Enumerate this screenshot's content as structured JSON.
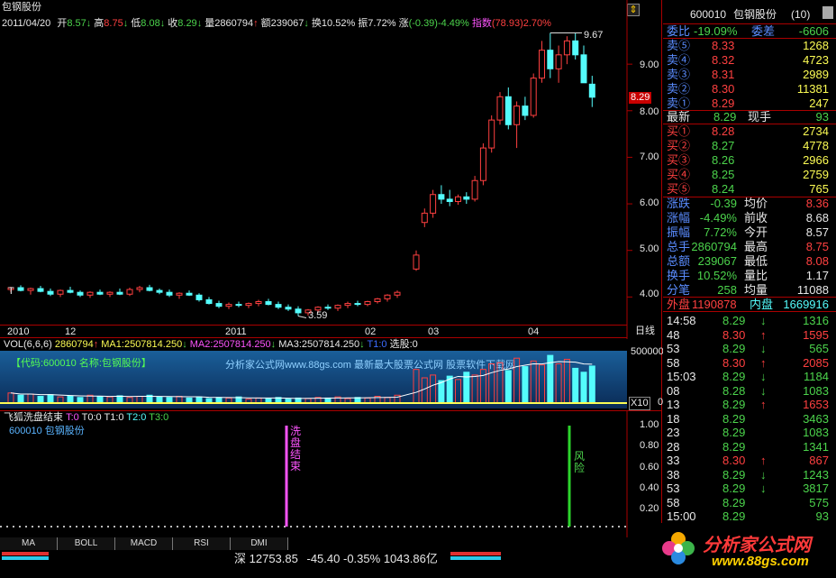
{
  "header": {
    "stock_name": "包钢股份",
    "date": "2011/04/20",
    "open_label": "开",
    "open": "8.57",
    "high_label": "高",
    "high": "8.75",
    "low_label": "低",
    "low": "8.08",
    "close_label": "收",
    "close": "8.29",
    "volume_label": "量",
    "volume": "2860794",
    "amount_label": "额",
    "amount": "239067",
    "turnover_label": "换",
    "turnover": "10.52%",
    "amplitude_label": "振",
    "amplitude": "7.72%",
    "change_label": "涨",
    "change": "(-0.39)-4.49%",
    "index_label": "指数",
    "index": "(78.93)2.70%"
  },
  "chart_data": {
    "type": "candlestick",
    "dates_labels": [
      "2010",
      "12",
      "2011",
      "02",
      "03",
      "04",
      "日线"
    ],
    "price_ticks": [
      "9.00",
      "8.00",
      "7.00",
      "6.00",
      "5.00",
      "4.00"
    ],
    "current_price": "8.29",
    "high_marker": "9.67",
    "low_marker": "3.59",
    "t_marker": "T",
    "ylim": [
      3.6,
      9.7
    ],
    "candles": [
      [
        4.16,
        4.22,
        4.1,
        4.2
      ],
      [
        4.2,
        4.25,
        4.12,
        4.14
      ],
      [
        4.14,
        4.2,
        4.05,
        4.18
      ],
      [
        4.18,
        4.24,
        4.1,
        4.12
      ],
      [
        4.12,
        4.18,
        4.02,
        4.06
      ],
      [
        4.06,
        4.16,
        4.0,
        4.14
      ],
      [
        4.14,
        4.22,
        4.08,
        4.1
      ],
      [
        4.1,
        4.14,
        4.0,
        4.04
      ],
      [
        4.04,
        4.12,
        3.98,
        4.1
      ],
      [
        4.1,
        4.16,
        4.04,
        4.06
      ],
      [
        4.06,
        4.12,
        4.0,
        4.1
      ],
      [
        4.1,
        4.18,
        4.04,
        4.06
      ],
      [
        4.06,
        4.2,
        4.02,
        4.16
      ],
      [
        4.16,
        4.24,
        4.1,
        4.2
      ],
      [
        4.2,
        4.26,
        4.12,
        4.14
      ],
      [
        4.14,
        4.18,
        4.06,
        4.1
      ],
      [
        4.1,
        4.16,
        4.0,
        4.04
      ],
      [
        4.04,
        4.1,
        3.96,
        4.08
      ],
      [
        4.08,
        4.14,
        4.02,
        4.04
      ],
      [
        4.04,
        4.08,
        3.9,
        3.94
      ],
      [
        3.94,
        4.0,
        3.84,
        3.86
      ],
      [
        3.86,
        3.92,
        3.76,
        3.8
      ],
      [
        3.8,
        3.88,
        3.74,
        3.84
      ],
      [
        3.84,
        3.9,
        3.78,
        3.82
      ],
      [
        3.82,
        3.88,
        3.76,
        3.86
      ],
      [
        3.86,
        3.94,
        3.8,
        3.9
      ],
      [
        3.9,
        3.96,
        3.82,
        3.84
      ],
      [
        3.84,
        3.9,
        3.74,
        3.78
      ],
      [
        3.78,
        3.84,
        3.7,
        3.74
      ],
      [
        3.74,
        3.8,
        3.59,
        3.66
      ],
      [
        3.66,
        3.74,
        3.6,
        3.72
      ],
      [
        3.72,
        3.8,
        3.66,
        3.78
      ],
      [
        3.78,
        3.84,
        3.72,
        3.76
      ],
      [
        3.76,
        3.84,
        3.7,
        3.82
      ],
      [
        3.82,
        3.9,
        3.76,
        3.86
      ],
      [
        3.86,
        3.92,
        3.8,
        3.84
      ],
      [
        3.84,
        3.92,
        3.8,
        3.9
      ],
      [
        3.9,
        3.98,
        3.86,
        3.96
      ],
      [
        3.96,
        4.06,
        3.9,
        4.04
      ],
      [
        4.04,
        4.14,
        3.98,
        4.1
      ],
      [
        4.6,
        5.0,
        4.56,
        4.9
      ],
      [
        5.6,
        5.9,
        5.5,
        5.8
      ],
      [
        5.8,
        6.3,
        5.7,
        6.2
      ],
      [
        6.2,
        6.4,
        6.0,
        6.1
      ],
      [
        6.1,
        6.3,
        5.95,
        6.05
      ],
      [
        6.05,
        6.2,
        5.98,
        6.15
      ],
      [
        6.15,
        6.25,
        6.0,
        6.1
      ],
      [
        6.1,
        6.6,
        6.05,
        6.5
      ],
      [
        6.5,
        7.3,
        6.4,
        7.2
      ],
      [
        7.2,
        7.9,
        7.1,
        7.8
      ],
      [
        7.8,
        8.4,
        7.7,
        8.3
      ],
      [
        8.3,
        8.5,
        7.6,
        7.7
      ],
      [
        7.7,
        8.2,
        7.2,
        8.1
      ],
      [
        8.1,
        8.3,
        7.8,
        7.9
      ],
      [
        7.9,
        8.8,
        7.85,
        8.7
      ],
      [
        8.7,
        9.5,
        8.6,
        9.3
      ],
      [
        9.3,
        9.67,
        8.7,
        8.9
      ],
      [
        8.9,
        9.4,
        8.6,
        9.2
      ],
      [
        9.2,
        9.6,
        9.0,
        9.5
      ],
      [
        9.5,
        9.67,
        9.1,
        9.2
      ],
      [
        9.2,
        9.4,
        8.8,
        8.6
      ],
      [
        8.57,
        8.75,
        8.08,
        8.29
      ]
    ],
    "volume_bars": [
      18,
      14,
      16,
      12,
      15,
      11,
      13,
      10,
      14,
      12,
      11,
      13,
      10,
      12,
      14,
      11,
      10,
      12,
      9,
      11,
      8,
      10,
      9,
      11,
      7,
      9,
      8,
      10,
      7,
      9,
      8,
      10,
      9,
      11,
      8,
      10,
      9,
      12,
      10,
      14,
      60,
      45,
      50,
      40,
      48,
      42,
      55,
      50,
      60,
      70,
      72,
      58,
      80,
      65,
      75,
      68,
      85,
      70,
      78,
      62,
      55,
      66
    ],
    "vol_axis": "500000",
    "vol_axis_zero": "0",
    "vol_multiplier": "X10"
  },
  "volume": {
    "title": "VOL(6,6,6)",
    "val": "2860794",
    "ma1_label": "MA1:",
    "ma1": "2507814.250",
    "ma2_label": "MA2:",
    "ma2": "2507814.250",
    "ma3_label": "MA3:",
    "ma3": "2507814.250",
    "t1_label": "T1:0",
    "xuan_label": "选股:0"
  },
  "watermark": {
    "code": "【代码:600010 名称:包钢股份】",
    "site": "分析家公式网www.88gs.com 最新最大股票公式网 股票软件下载网"
  },
  "indicator": {
    "name": "飞狐洗盘结束",
    "t": "T:0",
    "t0": "T0:0",
    "t1": "T1:0",
    "t2": "T2:0",
    "t3": "T3:0",
    "stock_line": "600010 包钢股份",
    "signal1": "洗盘结束",
    "signal2": "风险",
    "ticks": [
      "1.00",
      "0.80",
      "0.60",
      "0.40",
      "0.20"
    ]
  },
  "quote": {
    "title_code": "600010",
    "title_name": "包钢股份",
    "title_suffix": "(10)",
    "weibi_label": "委比",
    "weibi": "-19.09%",
    "weicha_label": "委差",
    "weicha": "-6606",
    "asks": [
      [
        "卖⑤",
        "8.33",
        "1268"
      ],
      [
        "卖④",
        "8.32",
        "4723"
      ],
      [
        "卖③",
        "8.31",
        "2989"
      ],
      [
        "卖②",
        "8.30",
        "11381"
      ],
      [
        "卖①",
        "8.29",
        "247"
      ]
    ],
    "latest_label": "最新",
    "latest": "8.29",
    "xianshou_label": "现手",
    "xianshou": "93",
    "bids": [
      [
        "买①",
        "8.28",
        "2734"
      ],
      [
        "买②",
        "8.27",
        "4778"
      ],
      [
        "买③",
        "8.26",
        "2966"
      ],
      [
        "买④",
        "8.25",
        "2759"
      ],
      [
        "买⑤",
        "8.24",
        "765"
      ]
    ],
    "stats": [
      [
        "涨跌",
        "-0.39",
        "均价",
        "8.36"
      ],
      [
        "涨幅",
        "-4.49%",
        "前收",
        "8.68"
      ],
      [
        "振幅",
        "7.72%",
        "今开",
        "8.57"
      ],
      [
        "总手",
        "2860794",
        "最高",
        "8.75"
      ],
      [
        "总额",
        "239067",
        "最低",
        "8.08"
      ],
      [
        "换手",
        "10.52%",
        "量比",
        "1.17"
      ],
      [
        "分笔",
        "258",
        "均量",
        "11088"
      ]
    ],
    "waipan_label": "外盘",
    "waipan": "1190878",
    "neipan_label": "内盘",
    "neipan": "1669916",
    "ticks": [
      [
        "14:58",
        "8.29",
        "↓",
        "1316"
      ],
      [
        "48",
        "8.30",
        "↑",
        "1595"
      ],
      [
        "53",
        "8.29",
        "↓",
        "565"
      ],
      [
        "58",
        "8.30",
        "↑",
        "2085"
      ],
      [
        "15:03",
        "8.29",
        "↓",
        "1184"
      ],
      [
        "08",
        "8.28",
        "↓",
        "1083"
      ],
      [
        "13",
        "8.29",
        "↑",
        "1653"
      ],
      [
        "18",
        "8.29",
        "",
        "3463"
      ],
      [
        "23",
        "8.29",
        "",
        "1083"
      ],
      [
        "28",
        "8.29",
        "",
        "1341"
      ],
      [
        "33",
        "8.30",
        "↑",
        "867"
      ],
      [
        "38",
        "8.29",
        "↓",
        "1243"
      ],
      [
        "53",
        "8.29",
        "↓",
        "3817"
      ],
      [
        "58",
        "8.29",
        "",
        "575"
      ],
      [
        "15:00",
        "8.29",
        "",
        "93"
      ]
    ]
  },
  "tabs": [
    "MA",
    "BOLL",
    "MACD",
    "RSI",
    "DMI"
  ],
  "status": {
    "market": "深",
    "index": "12753.85",
    "change": "-45.40",
    "pct": "-0.35%",
    "amount": "1043.86亿"
  },
  "logo": {
    "text": "分析家公式网",
    "url_text": "www.88gs.com"
  }
}
